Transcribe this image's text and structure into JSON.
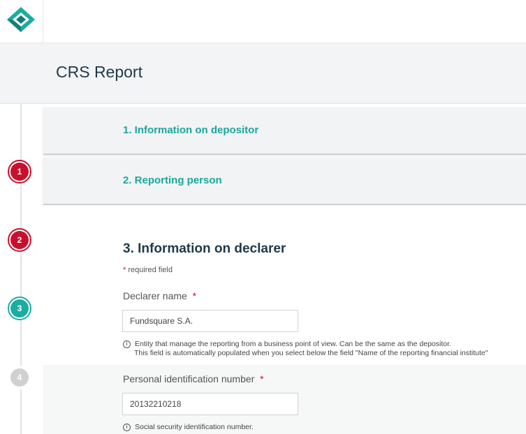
{
  "header": {
    "logo_icon": "diamond-logo-icon",
    "page_title": "CRS Report"
  },
  "colors": {
    "accent": "#1aada0",
    "done": "#c8102e",
    "pending": "#d0d0d0",
    "title": "#1e3a4a"
  },
  "stepper": {
    "steps": [
      {
        "label": "1",
        "state": "done"
      },
      {
        "label": "2",
        "state": "done"
      },
      {
        "label": "3",
        "state": "active"
      },
      {
        "label": "4",
        "state": "pending"
      }
    ]
  },
  "sections": [
    {
      "title": "1. Information on depositor"
    },
    {
      "title": "2. Reporting person"
    }
  ],
  "form": {
    "section_title": "3. Information on declarer",
    "required_star": "*",
    "required_note": "required field",
    "fields": [
      {
        "label": "Declarer name",
        "required_star": "*",
        "value": "Fundsquare S.A.",
        "help_line1": "Entity that manage the reporting from a business point of view. Can be the same as the depositor.",
        "help_line2": "This field is automatically populated when you select below the field \"Name of the reporting financial institute\""
      },
      {
        "label": "Personal identification number",
        "required_star": "*",
        "value": "20132210218",
        "help_line1": "Social security identification number."
      }
    ]
  }
}
